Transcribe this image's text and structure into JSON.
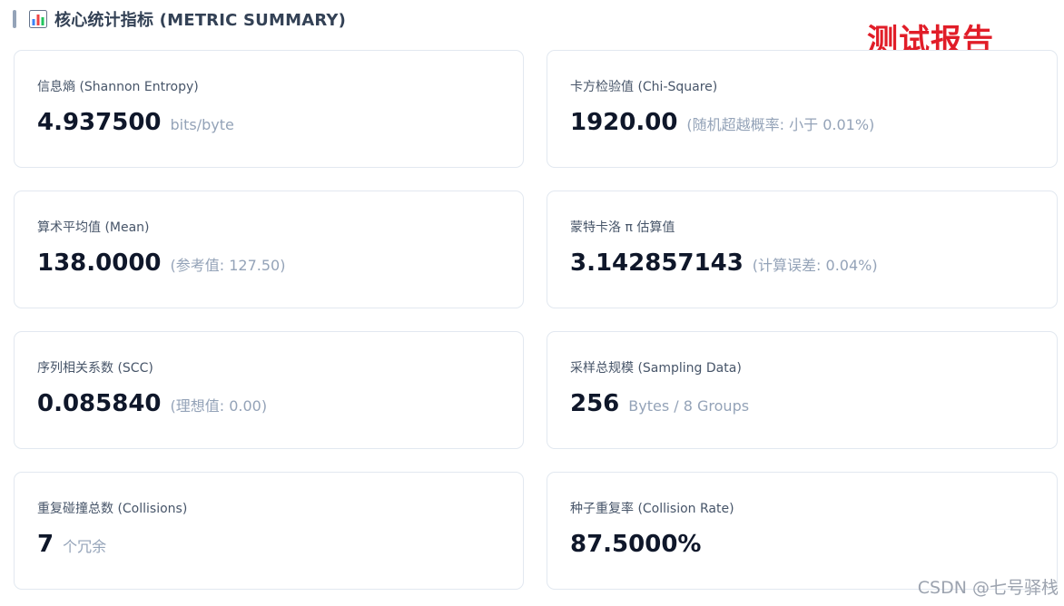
{
  "header": {
    "title": "核心统计指标 (METRIC SUMMARY)",
    "icon": "bar-chart-icon"
  },
  "stamp": {
    "text": "测试报告",
    "color": "#e11d28"
  },
  "cards": [
    {
      "label": "信息熵 (Shannon Entropy)",
      "value": "4.937500",
      "unit": "bits/byte"
    },
    {
      "label": "卡方检验值 (Chi-Square)",
      "value": "1920.00",
      "unit": "(随机超越概率: 小于 0.01%)"
    },
    {
      "label": "算术平均值 (Mean)",
      "value": "138.0000",
      "unit": "(参考值: 127.50)"
    },
    {
      "label": "蒙特卡洛 π 估算值",
      "value": "3.142857143",
      "unit": "(计算误差: 0.04%)"
    },
    {
      "label": "序列相关系数 (SCC)",
      "value": "0.085840",
      "unit": "(理想值: 0.00)"
    },
    {
      "label": "采样总规模 (Sampling Data)",
      "value": "256",
      "unit": "Bytes / 8 Groups"
    },
    {
      "label": "重复碰撞总数 (Collisions)",
      "value": "7",
      "unit": "个冗余"
    },
    {
      "label": "种子重复率 (Collision Rate)",
      "value": "87.5000%",
      "unit": ""
    }
  ],
  "watermark": {
    "text": "CSDN @七号驿栈"
  }
}
